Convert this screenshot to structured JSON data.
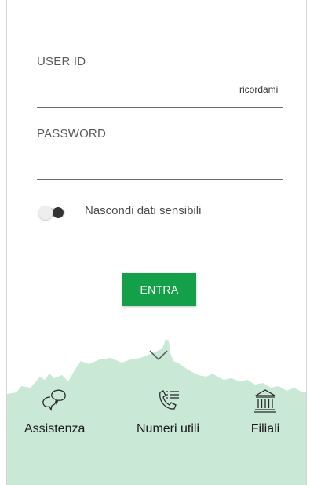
{
  "login": {
    "user_id_label": "USER ID",
    "remember_label": "ricordami",
    "password_label": "PASSWORD",
    "hide_sensitive_label": "Nascondi dati sensibili",
    "enter_button": "ENTRA"
  },
  "bottom_nav": {
    "items": [
      {
        "label": "Assistenza",
        "icon": "chat-bubbles-icon"
      },
      {
        "label": "Numeri utili",
        "icon": "phone-list-icon"
      },
      {
        "label": "Filiali",
        "icon": "bank-building-icon"
      }
    ]
  },
  "colors": {
    "accent": "#14a049",
    "skyline": "#c9e8d6",
    "icon_stroke": "#2a7a4a"
  }
}
